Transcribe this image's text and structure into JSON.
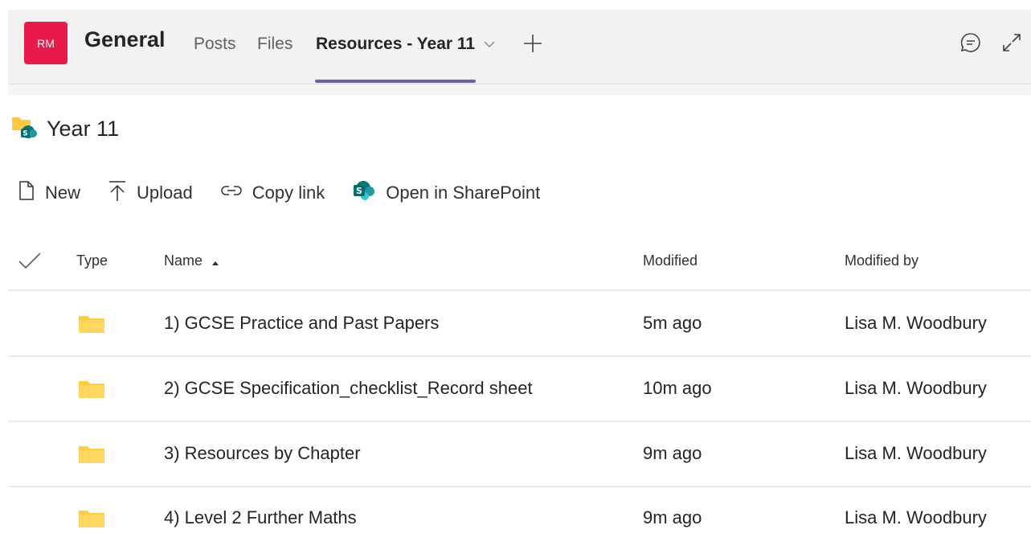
{
  "header": {
    "avatar_initials": "RM",
    "avatar_color": "#e8194b",
    "channel_title": "General",
    "tabs": [
      {
        "label": "Posts",
        "active": false
      },
      {
        "label": "Files",
        "active": false
      },
      {
        "label": "Resources - Year 11",
        "active": true
      }
    ],
    "accent_color": "#6264a7",
    "icons": [
      "chevron-down-icon",
      "add-tab-icon",
      "chat-icon",
      "expand-icon"
    ]
  },
  "breadcrumb": {
    "title": "Year 11",
    "icon": "sharepoint-folder-icon"
  },
  "toolbar": {
    "new_label": "New",
    "upload_label": "Upload",
    "copy_link_label": "Copy link",
    "open_sharepoint_label": "Open in SharePoint"
  },
  "table": {
    "columns": {
      "type": "Type",
      "name": "Name",
      "modified": "Modified",
      "modified_by": "Modified by"
    },
    "sort": {
      "column": "Name",
      "direction": "ascending"
    },
    "rows": [
      {
        "name": "1) GCSE Practice and Past Papers",
        "modified": "5m ago",
        "modified_by": "Lisa M. Woodbury",
        "type": "folder"
      },
      {
        "name": "2) GCSE Specification_checklist_Record sheet",
        "modified": "10m ago",
        "modified_by": "Lisa M. Woodbury",
        "type": "folder"
      },
      {
        "name": "3) Resources by Chapter",
        "modified": "9m ago",
        "modified_by": "Lisa M. Woodbury",
        "type": "folder"
      },
      {
        "name": "4) Level 2 Further Maths",
        "modified": "9m ago",
        "modified_by": "Lisa M. Woodbury",
        "type": "folder"
      }
    ]
  }
}
